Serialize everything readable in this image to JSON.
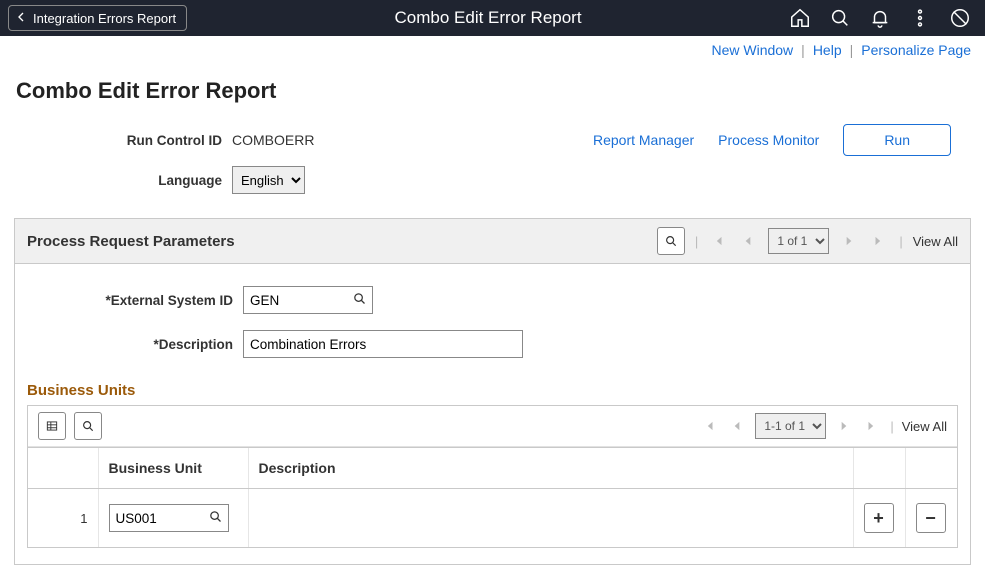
{
  "topbar": {
    "back_label": "Integration Errors Report",
    "title": "Combo Edit Error Report"
  },
  "page_links": {
    "new_window": "New Window",
    "help": "Help",
    "personalize": "Personalize Page"
  },
  "page_heading": "Combo Edit Error Report",
  "run_control": {
    "label": "Run Control ID",
    "value": "COMBOERR",
    "lang_label": "Language",
    "lang_value": "English",
    "report_manager": "Report Manager",
    "process_monitor": "Process Monitor",
    "run_btn": "Run"
  },
  "section": {
    "title": "Process Request Parameters",
    "pager": "1 of 1",
    "view_all": "View All",
    "ext_sys_label": "*External System ID",
    "ext_sys_value": "GEN",
    "desc_label": "*Description",
    "desc_value": "Combination Errors"
  },
  "grid": {
    "heading": "Business Units",
    "pager": "1-1 of 1",
    "view_all": "View All",
    "col_bu": "Business Unit",
    "col_desc": "Description",
    "rows": [
      {
        "num": "1",
        "bu": "US001",
        "desc": ""
      }
    ]
  }
}
